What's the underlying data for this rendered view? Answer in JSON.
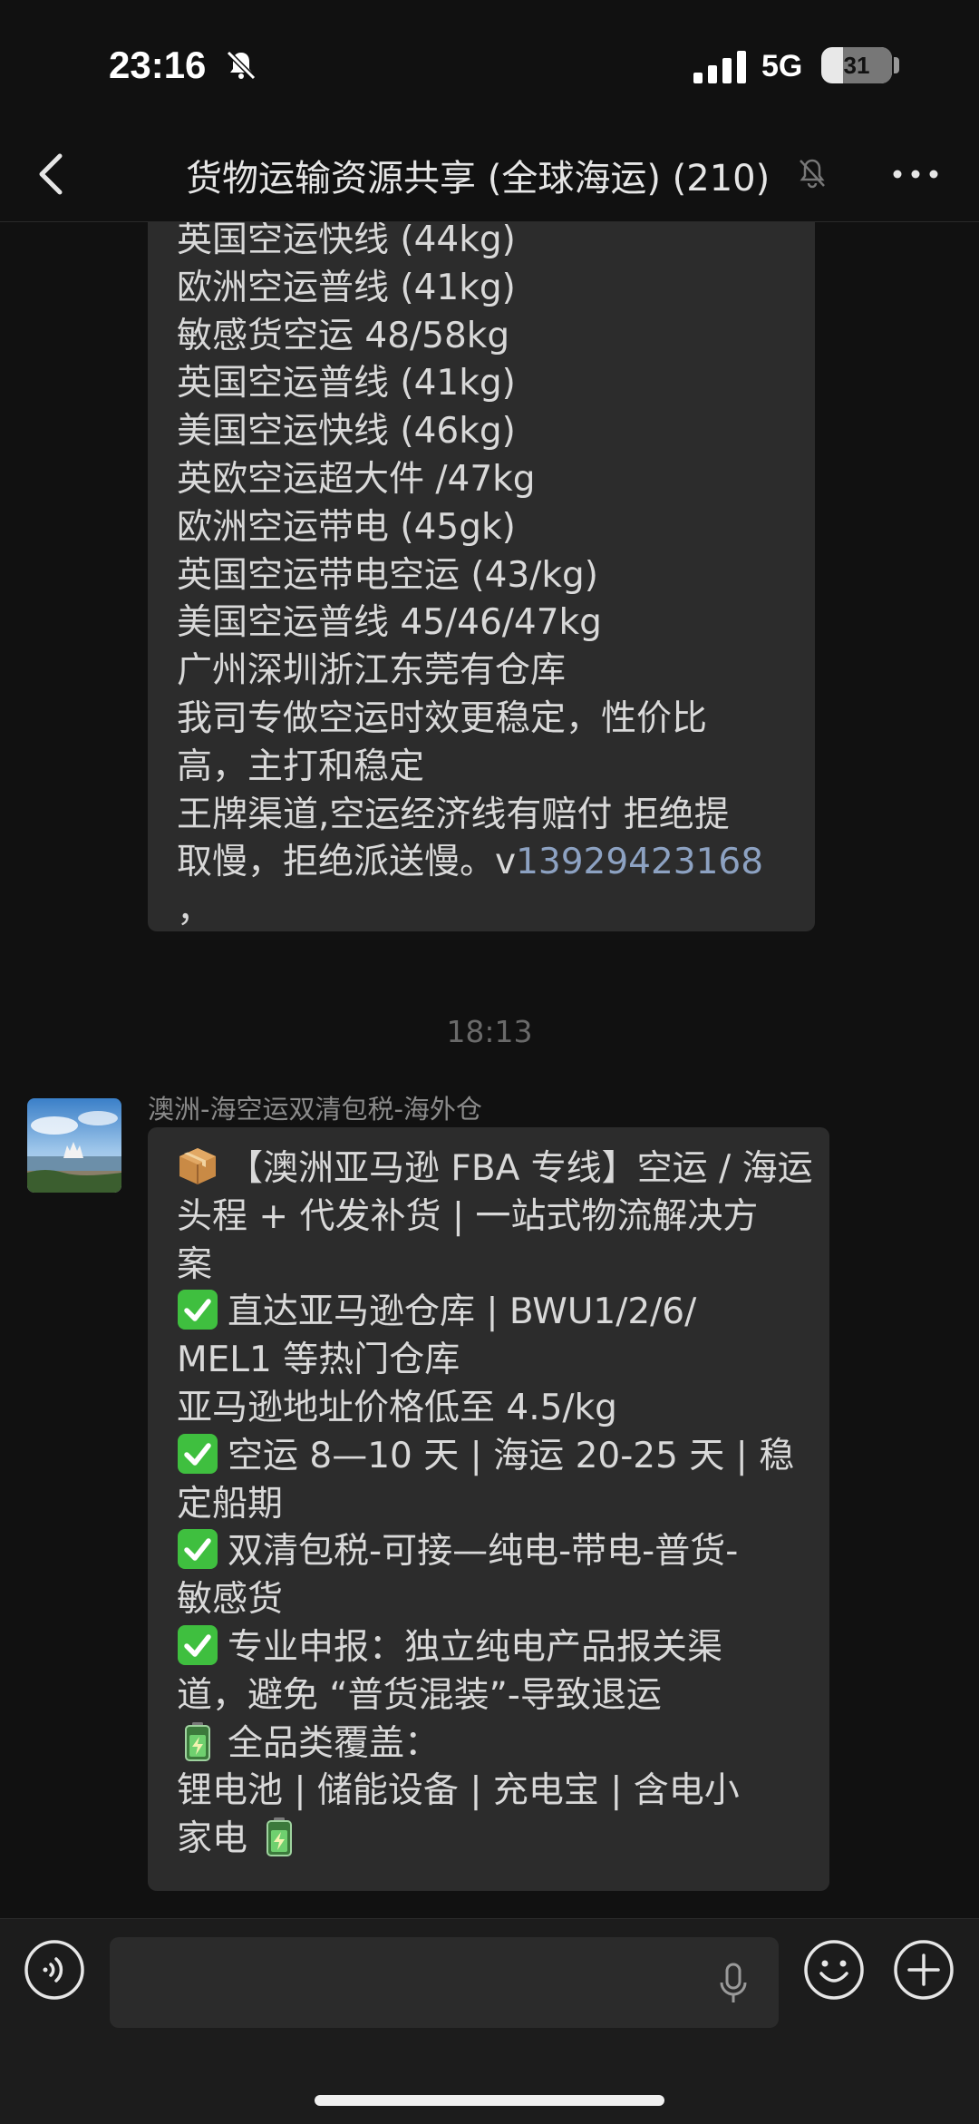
{
  "status": {
    "time": "23:16",
    "network": "5G",
    "battery": "31"
  },
  "header": {
    "title": "货物运输资源共享 (全球海运) (210)"
  },
  "messages": {
    "first": {
      "lines": [
        "英国空运快线 (44kg)",
        "欧洲空运普线 (41kg)",
        "敏感货空运 48/58kg",
        "英国空运普线 (41kg)",
        "美国空运快线 (46kg)",
        "英欧空运超大件 /47kg",
        "欧洲空运带电 (45gk)",
        "英国空运带电空运 (43/kg)",
        "美国空运普线 45/46/47kg",
        "广州深圳浙江东莞有仓库",
        "我司专做空运时效更稳定，性价比",
        "高，主打和稳定",
        "王牌渠道,空运经济线有赔付 拒绝提"
      ],
      "last_line_prefix": "取慢，拒绝派送慢。v",
      "phone": "13929423168",
      "tail": "，"
    },
    "timestamp": "18:13",
    "second": {
      "sender": "澳洲-海空运双清包税-海外仓",
      "lines": [
        {
          "icon": "package-emoji",
          "text": "【澳洲亚马逊 FBA 专线】空运 / 海运"
        },
        {
          "icon": "",
          "text": "头程 + 代发补货 | 一站式物流解决方"
        },
        {
          "icon": "",
          "text": "案"
        },
        {
          "icon": "check-emoji",
          "text": "直达亚马逊仓库 | BWU1/2/6/"
        },
        {
          "icon": "",
          "text": "MEL1 等热门仓库"
        },
        {
          "icon": "",
          "text": "亚马逊地址价格低至 4.5/kg"
        },
        {
          "icon": "check-emoji",
          "text": "空运 8—10 天 | 海运 20-25 天 | 稳"
        },
        {
          "icon": "",
          "text": "定船期"
        },
        {
          "icon": "check-emoji",
          "text": "双清包税-可接—纯电-带电-普货-"
        },
        {
          "icon": "",
          "text": "敏感货"
        },
        {
          "icon": "check-emoji",
          "text": "专业申报：独立纯电产品报关渠"
        },
        {
          "icon": "",
          "text": "道，避免 “普货混装”-导致退运"
        },
        {
          "icon": "battery-emoji",
          "text": "全品类覆盖："
        },
        {
          "icon": "",
          "text": "锂电池 | 储能设备 | 充电宝 | 含电小"
        },
        {
          "icon": "",
          "text": "家电"
        }
      ],
      "trailing_icon": "battery-emoji"
    }
  },
  "colors": {
    "background": "#111111",
    "bubble": "#2c2c2c",
    "link": "#8da2c2",
    "check": "#3fbf3f"
  }
}
